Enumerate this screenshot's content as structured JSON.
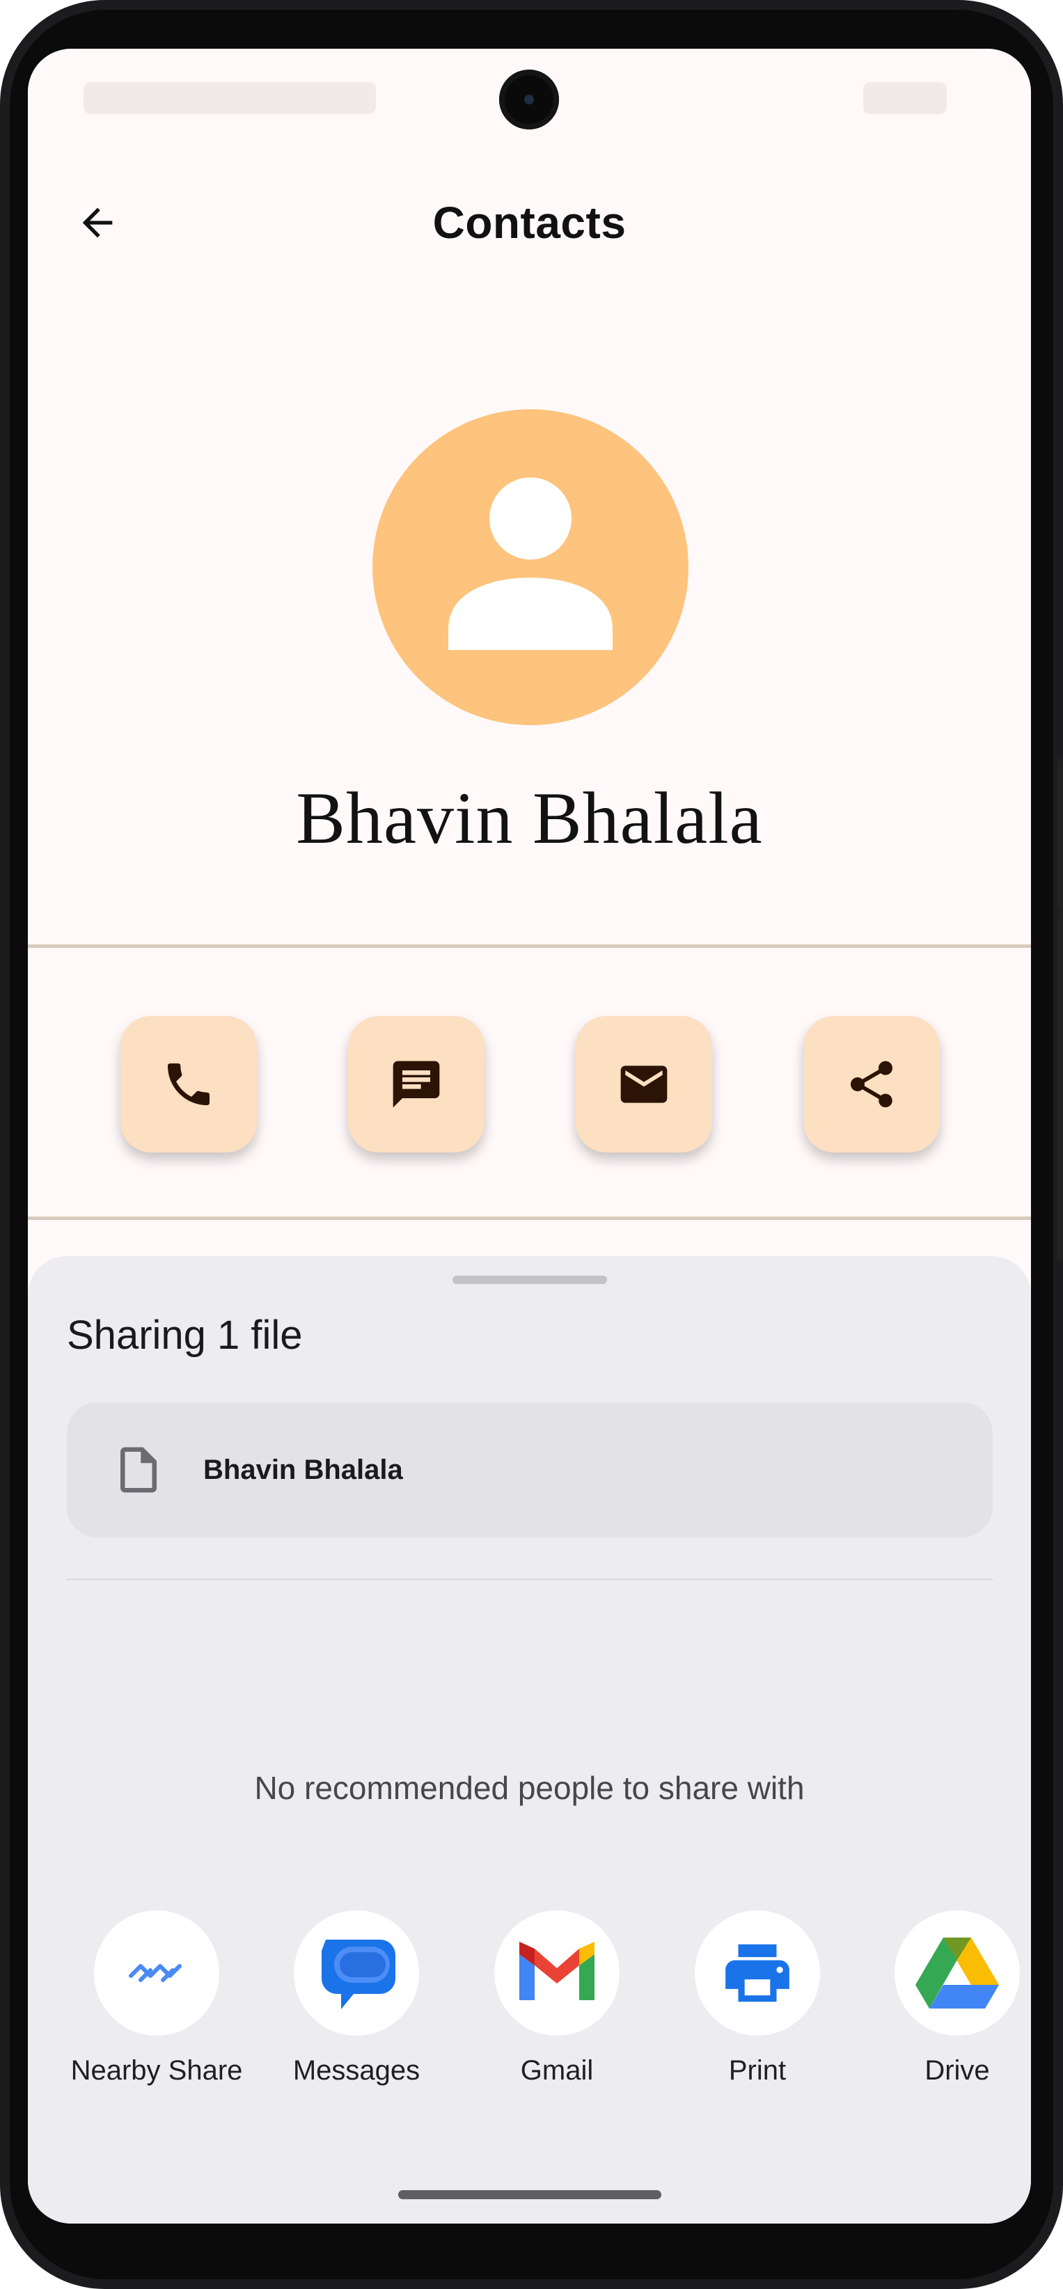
{
  "colors": {
    "screen_bg": "#fff9fa",
    "avatar_bg": "#fec37c",
    "action_button_bg": "#fddfc1",
    "action_icon": "#2b1405",
    "divider": "#d8cbbd",
    "sheet_bg": "#edecf0",
    "file_card_bg": "#e3e2e7"
  },
  "appbar": {
    "title": "Contacts",
    "back_icon": "arrow-back-icon"
  },
  "contact": {
    "name": "Bhavin Bhalala",
    "avatar_icon": "person-icon"
  },
  "actions": [
    {
      "icon": "phone-icon"
    },
    {
      "icon": "message-icon"
    },
    {
      "icon": "email-icon"
    },
    {
      "icon": "share-icon"
    }
  ],
  "share_sheet": {
    "title": "Sharing 1 file",
    "file_name": "Bhavin Bhalala",
    "file_icon": "file-icon",
    "empty_message": "No recommended people to share with",
    "targets": [
      {
        "label": "Nearby Share",
        "icon": "nearby-share-icon"
      },
      {
        "label": "Messages",
        "icon": "messages-icon"
      },
      {
        "label": "Gmail",
        "icon": "gmail-icon"
      },
      {
        "label": "Print",
        "icon": "print-icon"
      },
      {
        "label": "Drive",
        "icon": "drive-icon"
      }
    ]
  }
}
